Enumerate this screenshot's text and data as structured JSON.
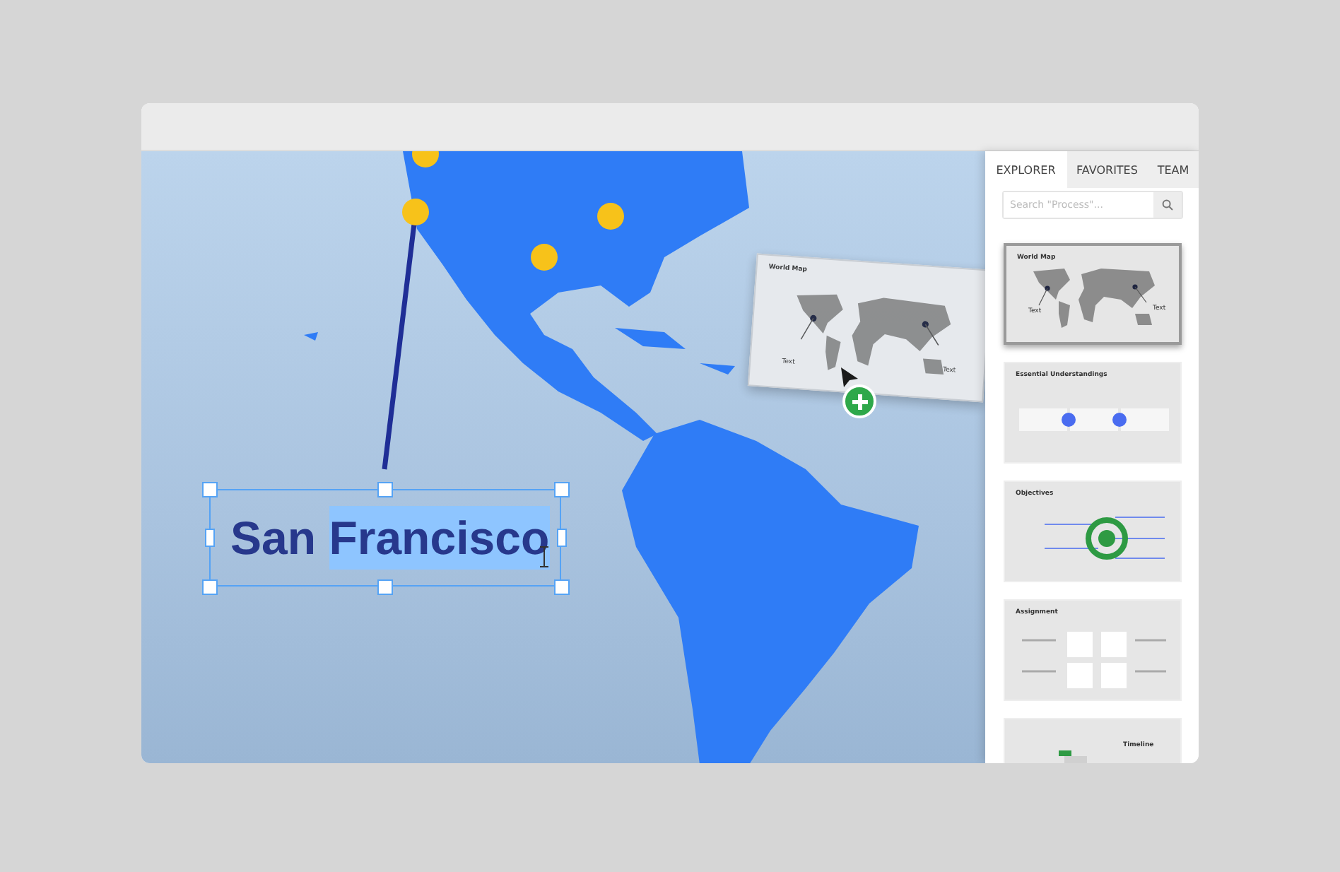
{
  "canvas": {
    "label": {
      "parts": [
        {
          "text": "San ",
          "selected": false
        },
        {
          "text": "Francisco",
          "selected": true
        }
      ]
    },
    "dragged_slide": {
      "title": "World Map",
      "labels": [
        "Text",
        "Text"
      ]
    }
  },
  "sidebar": {
    "tabs": [
      {
        "label": "EXPLORER",
        "selected": true
      },
      {
        "label": "FAVORITES",
        "selected": false
      },
      {
        "label": "TEAM",
        "selected": false
      }
    ],
    "search": {
      "placeholder": "Search \"Process\"..."
    },
    "slides": [
      {
        "kind": "map",
        "title": "World Map",
        "labels": [
          "Text",
          "Text"
        ],
        "selected": true
      },
      {
        "kind": "steps",
        "title": "Essential Understandings",
        "selected": false
      },
      {
        "kind": "target",
        "title": "Objectives",
        "selected": false
      },
      {
        "kind": "grid",
        "title": "Assignment",
        "selected": false
      },
      {
        "kind": "timeline",
        "title": "Timeline",
        "selected": false
      }
    ]
  }
}
